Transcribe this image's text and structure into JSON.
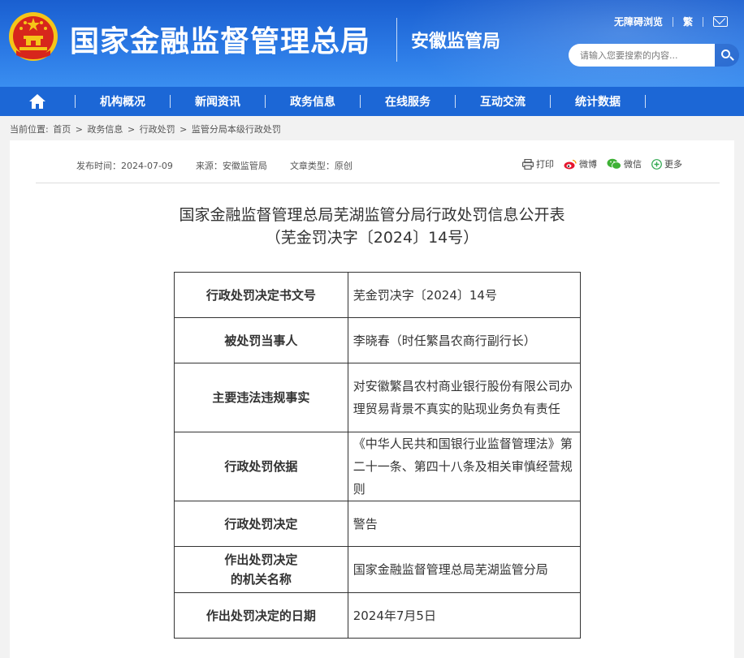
{
  "header": {
    "title": "国家金融监督管理总局",
    "subtitle": "安徽监管局",
    "accessibility_label": "无障碍浏览",
    "traditional_label": "繁",
    "search_placeholder": "请输入您要搜索的内容...",
    "colors": {
      "header_blue": "#2a78e4",
      "nav_blue": "#1c67d6",
      "emblem_red": "#d7261c",
      "emblem_gold": "#f5c518"
    }
  },
  "nav": {
    "items": [
      "机构概况",
      "新闻资讯",
      "政务信息",
      "在线服务",
      "互动交流",
      "统计数据"
    ]
  },
  "breadcrumb": {
    "label": "当前位置:",
    "items": [
      "首页",
      "政务信息",
      "行政处罚",
      "监管分局本级行政处罚"
    ],
    "separator": ">"
  },
  "meta": {
    "publish_time": "发布时间：2024-07-09",
    "source": "来源：安徽监管局",
    "doc_type": "文章类型：原创"
  },
  "share": {
    "print": "打印",
    "weibo": "微博",
    "wechat": "微信",
    "more": "更多"
  },
  "document": {
    "title_line1": "国家金融监督管理总局芜湖监管分局行政处罚信息公开表",
    "title_line2": "（芜金罚决字〔2024〕14号）",
    "rows": [
      {
        "key": "行政处罚决定书文号",
        "value": "芜金罚决字〔2024〕14号"
      },
      {
        "key": "被处罚当事人",
        "value": "李晓春（时任繁昌农商行副行长）"
      },
      {
        "key": "主要违法违规事实",
        "value": "对安徽繁昌农村商业银行股份有限公司办理贸易背景不真实的贴现业务负有责任"
      },
      {
        "key": "行政处罚依据",
        "value": "《中华人民共和国银行业监督管理法》第二十一条、第四十八条及相关审慎经营规则"
      },
      {
        "key": "行政处罚决定",
        "value": "警告"
      },
      {
        "key": "作出处罚决定的机关名称",
        "value": "国家金融监督管理总局芜湖监管分局"
      },
      {
        "key": "作出处罚决定的日期",
        "value": "2024年7月5日"
      }
    ]
  }
}
